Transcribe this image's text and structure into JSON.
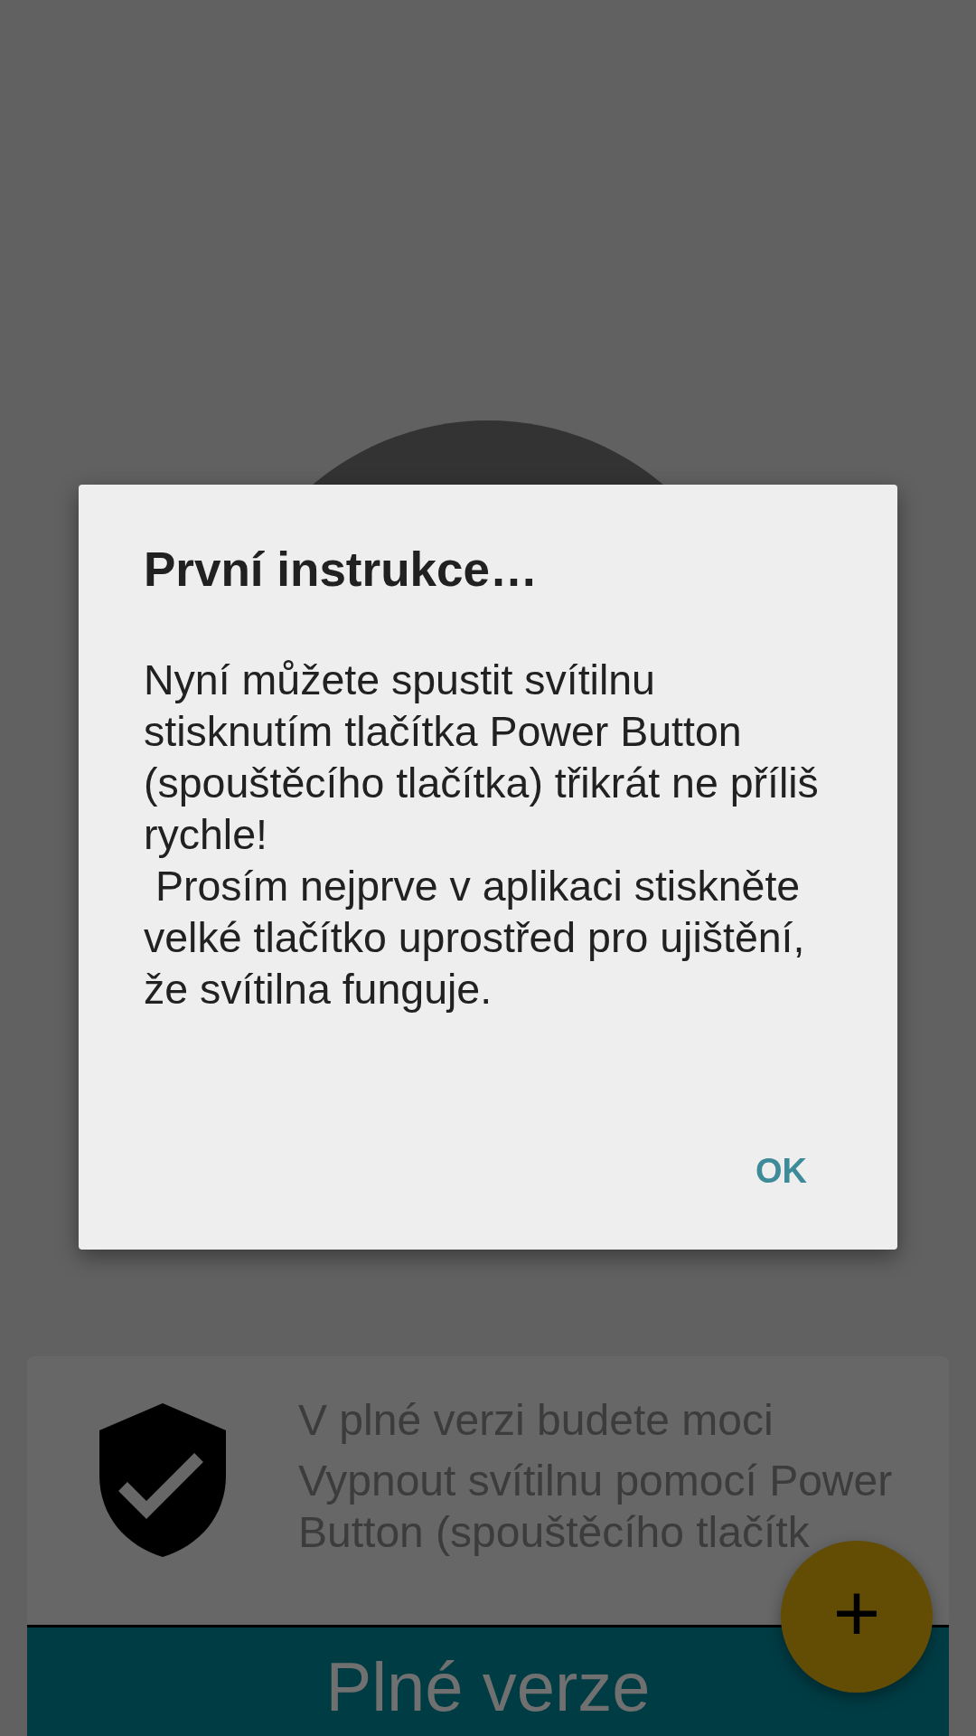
{
  "dialog": {
    "title": "První instrukce…",
    "message": "Nyní můžete spustit svítilnu stisknutím tlačítka Power Button (spouštěcího tlačítka) třikrát ne příliš rychle!\n Prosím nejprve v aplikaci stiskněte velké tlačítko uprostřed pro ujištění, že svítilna funguje.",
    "buttons": [
      "OK"
    ]
  },
  "promo_card": {
    "heading": "V plné verzi budete moci",
    "lines": [
      "Vypnout svítilnu pomocí Power",
      "Button (spouštěcího tlačítk"
    ],
    "button": "Plné verze"
  },
  "fab": {
    "label": "+"
  }
}
